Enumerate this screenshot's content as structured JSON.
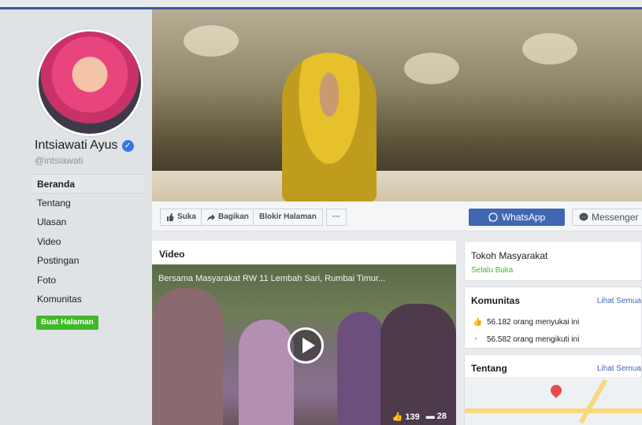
{
  "page": {
    "name": "Intsiawati Ayus",
    "handle": "@intsiawati"
  },
  "sidebar": {
    "items": [
      {
        "label": "Beranda"
      },
      {
        "label": "Tentang"
      },
      {
        "label": "Ulasan"
      },
      {
        "label": "Video"
      },
      {
        "label": "Postingan"
      },
      {
        "label": "Foto"
      },
      {
        "label": "Komunitas"
      }
    ],
    "create_page": "Buat Halaman"
  },
  "actions": {
    "like": "Suka",
    "share": "Bagikan",
    "block": "Blokir Halaman",
    "more": "···",
    "whatsapp": "WhatsApp",
    "messenger": "Messenger"
  },
  "video": {
    "section_title": "Video",
    "caption": "Bersama Masyarakat RW 11 Lembah Sari, Rumbai Timur...",
    "likes": "139",
    "comments": "28"
  },
  "info": {
    "category": "Tokoh Masyarakat",
    "hours": "Selalu Buka"
  },
  "community": {
    "title": "Komunitas",
    "see_all": "Lihat Semua",
    "likes_text": "56.182 orang menyukai ini",
    "follows_text": "56.582 orang mengikuti ini"
  },
  "about": {
    "title": "Tentang",
    "see_all": "Lihat Semua"
  },
  "colors": {
    "brand_blue": "#3b5998",
    "button_blue": "#4267b2",
    "green": "#42b72a",
    "verified": "#3578e5"
  },
  "icons": [
    "verified-badge-icon",
    "thumbs-up-icon",
    "share-arrow-icon",
    "whatsapp-icon",
    "messenger-icon",
    "play-icon",
    "comment-icon",
    "rss-icon",
    "map-pin-icon"
  ]
}
